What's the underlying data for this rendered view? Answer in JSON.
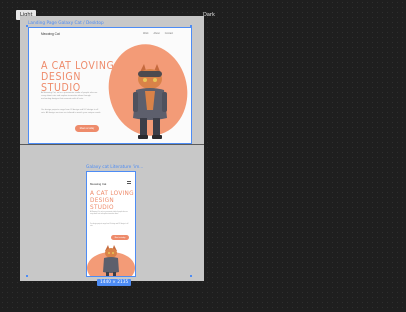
{
  "theme_labels": {
    "light": "Light",
    "dark": "Dark"
  },
  "desktop_frame": {
    "label": "Landing Page Galaxy Cat / Desktop",
    "nav_logo": "Meowing Cat",
    "nav_items": [
      "Work",
      "About",
      "Contact"
    ],
    "title": "A CAT LOVING DESIGN STUDIO",
    "body_1": "At Meowing Cat, we're a passionate studio of people who are crazy about cats and explore innovative ideas through enchanting designs that resonate with all cats.",
    "body_2": "Our design projects range from UI design and UX design to all cats. All design services are tailored to match your unique needs.",
    "cta": "Meet us today"
  },
  "mobile_frame": {
    "label": "Galaxy cat Literature 'im...",
    "nav_logo": "Meowing Cat",
    "title": "A CAT LOVING DESIGN STUDIO",
    "body_1": "At Meowing Cat, we're a passionate studio of people who are crazy about cats and explore innovative ideas.",
    "body_2": "Our design projects range from UI design and UX design to all cats.",
    "cta": "Meet us today"
  },
  "selection_size": "1440 × 2135",
  "colors": {
    "accent": "#ee8b6b",
    "selection": "#4d8cf5",
    "canvas": "#1f1f1f"
  }
}
